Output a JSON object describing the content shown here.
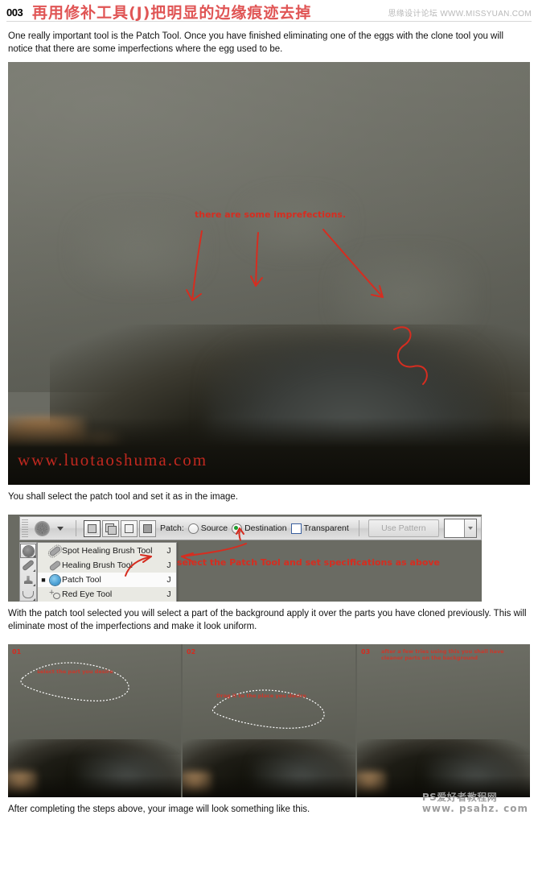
{
  "header": {
    "number": "003",
    "title_cn": "再用修补工具(J)把明显的边缘痕迹去掉",
    "watermark": "思缘设计论坛 WWW.MISSYUAN.COM"
  },
  "body": {
    "intro_paragraph": "One really important tool is the Patch Tool. Once you have finished eliminating one of the eggs with the clone tool you will notice that there are some imperfections where the egg used to be.",
    "caption_select_tool": "You shall select the patch tool and set it as in the image.",
    "paragraph_after_toolbar": "With the patch tool selected you will select a part of the background apply it over the parts you have cloned previously. This will eliminate most of the imperfections and make it look uniform.",
    "closing_caption": "After completing the steps above, your image will look something like this."
  },
  "photo1": {
    "annotation": "there are some imprefections.",
    "watermark": "www.luotaoshuma.com"
  },
  "photoshop": {
    "options_bar": {
      "brush_label": "brush-preview",
      "selection_modes": [
        "new-selection",
        "add-to-selection",
        "subtract-from-selection",
        "intersect-with-selection"
      ],
      "patch_label": "Patch:",
      "radio_source": "Source",
      "radio_destination": "Destination",
      "radio_selected": "Destination",
      "checkbox_transparent": "Transparent",
      "checkbox_transparent_checked": false,
      "use_pattern_button": "Use Pattern",
      "use_pattern_disabled": true
    },
    "tool_flyout": {
      "items": [
        {
          "label": "Spot Healing Brush Tool",
          "key": "J",
          "selected": false
        },
        {
          "label": "Healing Brush Tool",
          "key": "J",
          "selected": false
        },
        {
          "label": "Patch Tool",
          "key": "J",
          "selected": true
        },
        {
          "label": "Red Eye Tool",
          "key": "J",
          "selected": false
        }
      ]
    },
    "annotation": "select the Patch Tool and set specifications as above"
  },
  "triptych": {
    "panels": [
      {
        "number": "01",
        "annotation": "select the part you desire"
      },
      {
        "number": "02",
        "annotation": "Drag it to the place you desire"
      },
      {
        "number": "03",
        "annotation": "after a few tries using this you shall have cleaner parts on the background"
      }
    ]
  },
  "footer": {
    "watermark_line1": "PS爱好者教程网",
    "watermark_line2": "www. psahz. com"
  },
  "colors": {
    "accent_red": "#d62d20",
    "header_red": "#e05555",
    "watermark_gray": "#b9b9b9",
    "photo_bg": "#6a6b63"
  }
}
